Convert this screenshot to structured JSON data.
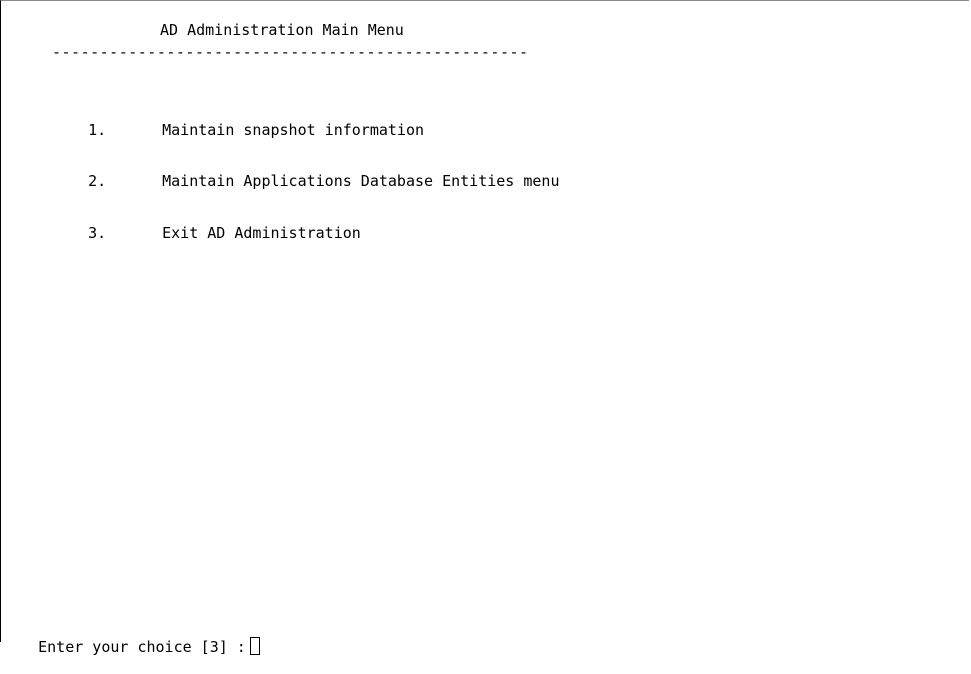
{
  "menu": {
    "title": "AD Administration Main Menu",
    "separator": "--------------------------------------------------",
    "items": [
      {
        "number": "1.",
        "label": "Maintain snapshot information"
      },
      {
        "number": "2.",
        "label": "Maintain Applications Database Entities menu"
      },
      {
        "number": "3.",
        "label": "Exit AD Administration"
      }
    ]
  },
  "prompt": {
    "text": "Enter your choice [3] :"
  }
}
